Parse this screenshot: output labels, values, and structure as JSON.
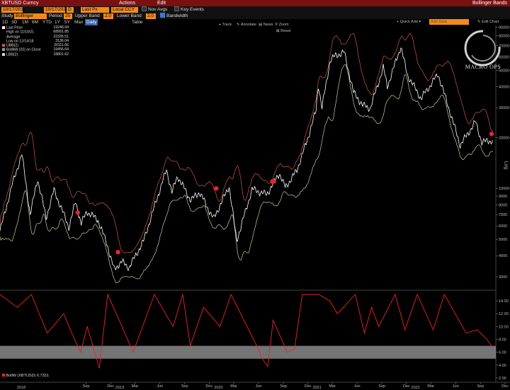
{
  "title_bar": {
    "ticker": "XBTUSD Curncy",
    "actions": "Actions",
    "edit": "Edit",
    "right": "Bollinger Bands"
  },
  "settings": {
    "start_date": "10/17/2015",
    "end_date": "10/17/2022",
    "period_btn": "D",
    "last_px": "Last Px",
    "currency": "Local CCY",
    "nov_avgs": "Nov Avgs",
    "key_events": "Key Events",
    "study_label": "Study",
    "study_value": "Bollinger",
    "period_label": "Period",
    "period_value": "20",
    "upper_label": "Upper Band",
    "upper_value": "2.0",
    "lower_label": "Lower Band",
    "lower_value": "2.0",
    "bandwidth": "Bandwidth"
  },
  "timeframes": [
    "1D",
    "3D",
    "1M",
    "6M",
    "YTD",
    "1Y",
    "5Y",
    "Max"
  ],
  "freq": "Daily",
  "table_btn": "Table",
  "tools": [
    "Track",
    "Annotate",
    "News",
    "Zoom"
  ],
  "reset": "Reset",
  "quick_add": "Quick Add",
  "add_data": "Add Data",
  "edit_chart": "Edit Chart",
  "watermark": {
    "brand": "MACRO OPS"
  },
  "legend": [
    {
      "label": "Last Price",
      "value": "19248.94",
      "color": "#ffffff"
    },
    {
      "label": "High on 11/10/21",
      "value": "68991.85",
      "color": ""
    },
    {
      "label": "Average",
      "value": "22335.51",
      "color": ""
    },
    {
      "label": "Low on 12/14/18",
      "value": "3136.04",
      "color": ""
    },
    {
      "label": "UBB(2)",
      "value": "20111.66",
      "color": "#c8584c"
    },
    {
      "label": "BollMA (20) on Close",
      "value": "19456.64",
      "color": "#999999"
    },
    {
      "label": "LBB(2)",
      "value": "18801.62",
      "color": "#d8d8b0"
    }
  ],
  "lower_legend": {
    "label": "BollW (XBTUSD)",
    "value": "6.7331"
  },
  "colors": {
    "price": "#ffffff",
    "upper": "#c8584c",
    "lower": "#c9cf9a",
    "signal": "#e8242f",
    "bandwidth": "#e8242f",
    "band_zone": "#8a8a8a"
  },
  "chart_data": {
    "type": "line",
    "ylabel": "Log",
    "y_ticks": [
      "90000",
      "80000",
      "70000",
      "60000",
      "50000",
      "40000",
      "30000",
      "20000",
      "10000",
      "9000",
      "8000",
      "7000",
      "6000",
      "5000",
      "4000",
      "3000"
    ],
    "y_scale": "log",
    "price_series": [
      {
        "date": "2017-10-17",
        "value": 5600
      },
      {
        "date": "2017-12-01",
        "value": 10500
      },
      {
        "date": "2018-01-06",
        "value": 16000
      },
      {
        "date": "2018-02-06",
        "value": 7000
      },
      {
        "date": "2018-03-05",
        "value": 11400
      },
      {
        "date": "2018-04-06",
        "value": 6700
      },
      {
        "date": "2018-05-05",
        "value": 9800
      },
      {
        "date": "2018-06-29",
        "value": 5900
      },
      {
        "date": "2018-07-24",
        "value": 8300
      },
      {
        "date": "2018-08-14",
        "value": 6200
      },
      {
        "date": "2018-09-04",
        "value": 7300
      },
      {
        "date": "2018-10-15",
        "value": 6500
      },
      {
        "date": "2018-11-19",
        "value": 4600
      },
      {
        "date": "2018-12-14",
        "value": 3300
      },
      {
        "date": "2019-01-10",
        "value": 3700
      },
      {
        "date": "2019-02-07",
        "value": 3400
      },
      {
        "date": "2019-04-02",
        "value": 4900
      },
      {
        "date": "2019-05-14",
        "value": 8000
      },
      {
        "date": "2019-06-26",
        "value": 12900
      },
      {
        "date": "2019-07-16",
        "value": 9500
      },
      {
        "date": "2019-08-06",
        "value": 11800
      },
      {
        "date": "2019-09-24",
        "value": 8500
      },
      {
        "date": "2019-10-26",
        "value": 9500
      },
      {
        "date": "2019-12-17",
        "value": 6600
      },
      {
        "date": "2020-02-13",
        "value": 10300
      },
      {
        "date": "2020-03-12",
        "value": 4900
      },
      {
        "date": "2020-05-08",
        "value": 9900
      },
      {
        "date": "2020-07-01",
        "value": 9200
      },
      {
        "date": "2020-08-17",
        "value": 12300
      },
      {
        "date": "2020-09-08",
        "value": 10100
      },
      {
        "date": "2020-10-21",
        "value": 12800
      },
      {
        "date": "2020-11-30",
        "value": 19700
      },
      {
        "date": "2020-12-31",
        "value": 29000
      },
      {
        "date": "2021-01-08",
        "value": 41000
      },
      {
        "date": "2021-01-22",
        "value": 30000
      },
      {
        "date": "2021-02-21",
        "value": 57000
      },
      {
        "date": "2021-03-13",
        "value": 61000
      },
      {
        "date": "2021-04-14",
        "value": 64000
      },
      {
        "date": "2021-05-19",
        "value": 37000
      },
      {
        "date": "2021-06-22",
        "value": 31000
      },
      {
        "date": "2021-07-20",
        "value": 29800
      },
      {
        "date": "2021-09-06",
        "value": 52000
      },
      {
        "date": "2021-09-21",
        "value": 40000
      },
      {
        "date": "2021-11-10",
        "value": 68991.85
      },
      {
        "date": "2021-12-04",
        "value": 47000
      },
      {
        "date": "2022-01-24",
        "value": 34000
      },
      {
        "date": "2022-03-28",
        "value": 47500
      },
      {
        "date": "2022-05-12",
        "value": 28000
      },
      {
        "date": "2022-06-18",
        "value": 18000
      },
      {
        "date": "2022-08-14",
        "value": 24800
      },
      {
        "date": "2022-09-06",
        "value": 18800
      },
      {
        "date": "2022-10-17",
        "value": 19248.94
      }
    ],
    "signal_points": [
      {
        "date": "2018-08-01",
        "value": 7200
      },
      {
        "date": "2018-12-28",
        "value": 4200
      },
      {
        "date": "2019-12-27",
        "value": 10000
      },
      {
        "date": "2020-07-22",
        "value": 11000
      },
      {
        "date": "2020-07-28",
        "value": 11000
      },
      {
        "date": "2022-10-12",
        "value": 21000
      }
    ],
    "bandwidth_series": [
      {
        "date": "2017-10-17",
        "value": 15
      },
      {
        "date": "2017-12-20",
        "value": 13
      },
      {
        "date": "2018-02-10",
        "value": 15
      },
      {
        "date": "2018-04-10",
        "value": 9
      },
      {
        "date": "2018-06-10",
        "value": 12
      },
      {
        "date": "2018-07-20",
        "value": 8
      },
      {
        "date": "2018-08-12",
        "value": 6
      },
      {
        "date": "2018-09-05",
        "value": 10
      },
      {
        "date": "2018-10-20",
        "value": 3.5
      },
      {
        "date": "2018-11-20",
        "value": 15
      },
      {
        "date": "2019-01-12",
        "value": 10
      },
      {
        "date": "2019-02-22",
        "value": 6
      },
      {
        "date": "2019-05-12",
        "value": 15
      },
      {
        "date": "2019-07-20",
        "value": 10
      },
      {
        "date": "2019-08-25",
        "value": 15
      },
      {
        "date": "2019-09-22",
        "value": 7
      },
      {
        "date": "2019-11-10",
        "value": 13
      },
      {
        "date": "2020-01-10",
        "value": 10
      },
      {
        "date": "2020-02-20",
        "value": 15
      },
      {
        "date": "2020-05-25",
        "value": 7
      },
      {
        "date": "2020-06-15",
        "value": 5
      },
      {
        "date": "2020-07-05",
        "value": 3.8
      },
      {
        "date": "2020-07-25",
        "value": 11
      },
      {
        "date": "2020-09-15",
        "value": 6
      },
      {
        "date": "2020-10-12",
        "value": 6.5
      },
      {
        "date": "2020-11-10",
        "value": 15
      },
      {
        "date": "2021-01-10",
        "value": 15
      },
      {
        "date": "2021-02-20",
        "value": 14
      },
      {
        "date": "2021-03-20",
        "value": 12
      },
      {
        "date": "2021-05-25",
        "value": 15
      },
      {
        "date": "2021-06-28",
        "value": 9
      },
      {
        "date": "2021-07-25",
        "value": 13
      },
      {
        "date": "2021-08-20",
        "value": 10
      },
      {
        "date": "2021-10-20",
        "value": 15
      },
      {
        "date": "2021-11-25",
        "value": 9.5
      },
      {
        "date": "2022-01-10",
        "value": 15
      },
      {
        "date": "2022-03-10",
        "value": 9.5
      },
      {
        "date": "2022-04-20",
        "value": 15
      },
      {
        "date": "2022-07-10",
        "value": 9
      },
      {
        "date": "2022-08-20",
        "value": 9.5
      },
      {
        "date": "2022-09-25",
        "value": 8
      },
      {
        "date": "2022-10-17",
        "value": 6.7331
      }
    ],
    "bandwidth_zone": [
      5,
      7
    ],
    "bandwidth_ticks": [
      "14.00",
      "12.00",
      "10.00",
      "8.00",
      "6.00",
      "4.00",
      "2.00"
    ],
    "x_ticks": [
      "Sep",
      "Dec",
      "Mar",
      "Jun",
      "Sep",
      "Dec",
      "Mar",
      "Jun",
      "Sep",
      "Dec",
      "Mar",
      "Jun",
      "Sep",
      "Dec",
      "Mar",
      "Jun",
      "Sep",
      "Dec",
      "Mar",
      "Jun",
      "Sep"
    ],
    "x_years": [
      "2018",
      "2019",
      "2020",
      "2021",
      "2022"
    ]
  }
}
